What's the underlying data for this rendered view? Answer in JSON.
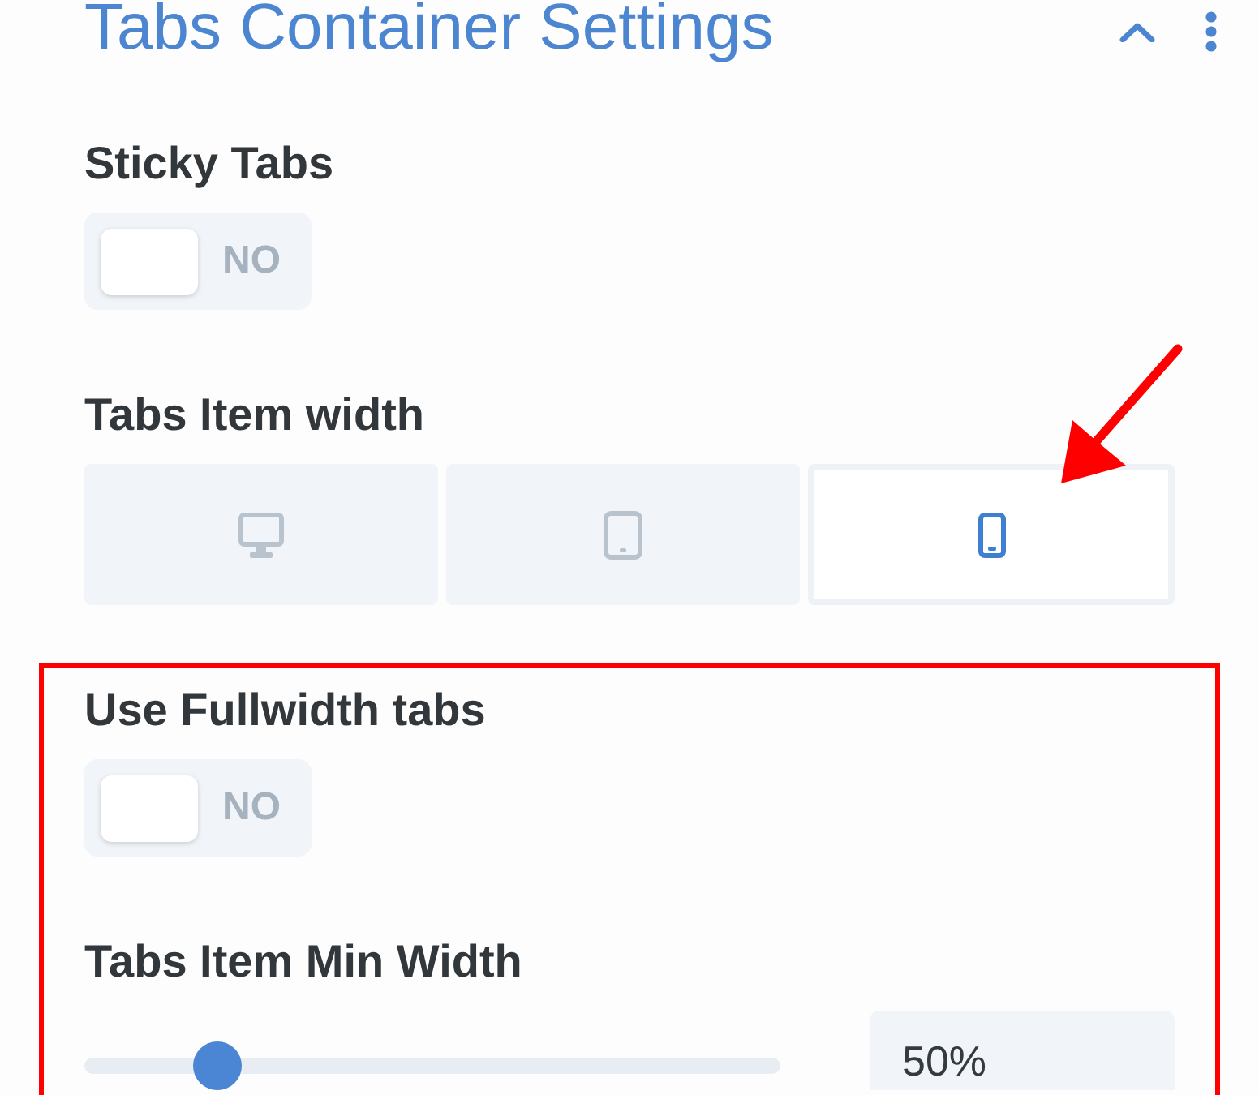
{
  "section": {
    "title": "Tabs Container Settings",
    "expanded": true
  },
  "fields": [
    {
      "kind": "toggle",
      "label": "Sticky Tabs",
      "on": false,
      "state_text": "NO"
    },
    {
      "kind": "devices",
      "label": "Tabs Item width",
      "options": [
        {
          "kind": "desktop",
          "selected": false
        },
        {
          "kind": "tablet",
          "selected": false
        },
        {
          "kind": "phone",
          "selected": true
        }
      ]
    },
    {
      "kind": "toggle",
      "label": "Use Fullwidth tabs",
      "on": false,
      "state_text": "NO"
    },
    {
      "kind": "slider",
      "label": "Tabs Item Min Width",
      "level": 0.19,
      "value": "50%"
    }
  ]
}
